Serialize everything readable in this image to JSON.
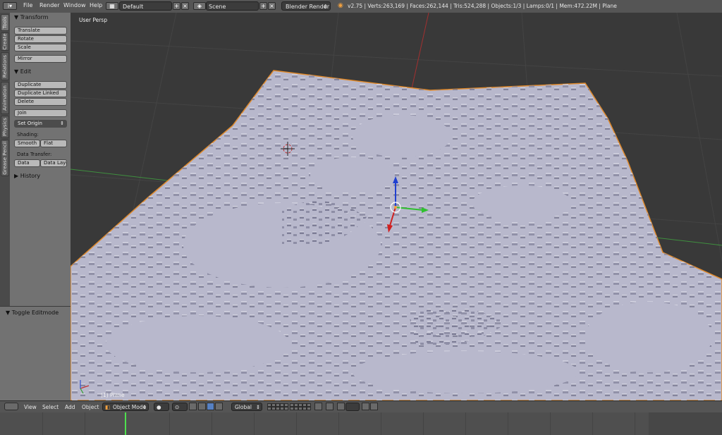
{
  "header": {
    "menus": [
      "File",
      "Render",
      "Window",
      "Help"
    ],
    "screen_layout": "Default",
    "scene": "Scene",
    "render_engine": "Blender Render",
    "stats": "v2.75 | Verts:263,169 | Faces:262,144 | Tris:524,288 | Objects:1/3 | Lamps:0/1 | Mem:472.22M | Plane"
  },
  "tabs": [
    "Tools",
    "Create",
    "Relations",
    "Animation",
    "Physics",
    "Grease Pencil"
  ],
  "tools": {
    "transform_header": "Transform",
    "translate": "Translate",
    "rotate": "Rotate",
    "scale": "Scale",
    "mirror": "Mirror",
    "edit_header": "Edit",
    "duplicate": "Duplicate",
    "duplicate_linked": "Duplicate Linked",
    "delete": "Delete",
    "join": "Join",
    "set_origin": "Set Origin",
    "shading_label": "Shading:",
    "smooth": "Smooth",
    "flat": "Flat",
    "data_transfer_label": "Data Transfer:",
    "data": "Data",
    "data_layout": "Data Layo",
    "history_header": "History"
  },
  "operator_panel": {
    "header": "Toggle Editmode"
  },
  "viewport": {
    "view_label": "User Persp",
    "object_label": "(1) Plane"
  },
  "bottom": {
    "menus": [
      "View",
      "Select",
      "Add",
      "Object"
    ],
    "mode": "Object Mode",
    "orientation": "Global"
  },
  "colors": {
    "terrain": "#b8b8cc",
    "terrain_shadow": "#8a8aa2",
    "selection_outline": "#e08a2c",
    "axis_red": "#a23030",
    "axis_green": "#3f8f3f",
    "frame_cursor": "#4ee04e"
  }
}
